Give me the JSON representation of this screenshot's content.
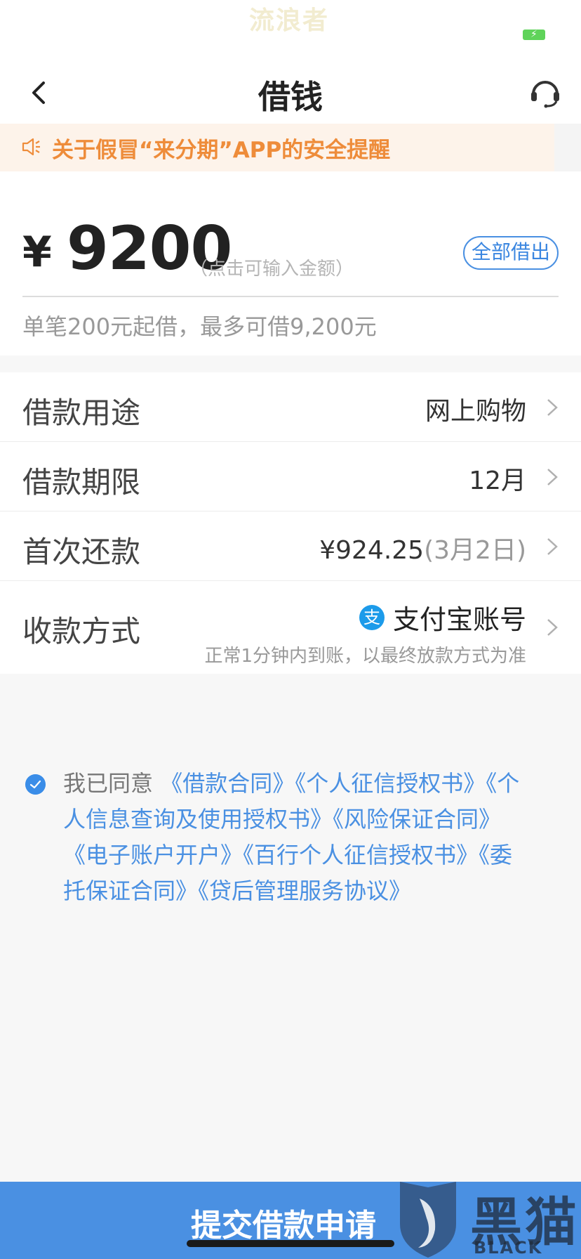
{
  "status_bar": {
    "watermark_text": "流浪者"
  },
  "nav": {
    "title": "借钱"
  },
  "notice": {
    "text": "关于假冒“来分期”APP的安全提醒"
  },
  "amount": {
    "currency": "¥",
    "value": "9200",
    "hint": "（点击可输入金额）",
    "borrow_all_label": "全部借出",
    "limit_note": "单笔200元起借，最多可借9,200元"
  },
  "options": [
    {
      "label": "借款用途",
      "value": "网上购物"
    },
    {
      "label": "借款期限",
      "value": "12月"
    },
    {
      "label": "首次还款",
      "value": "¥924.25",
      "value_sub": "(3月2日)"
    },
    {
      "label": "收款方式",
      "value": "支付宝账号",
      "note": "正常1分钟内到账，以最终放款方式为准",
      "icon_char": "支"
    }
  ],
  "agreement": {
    "prefix": "我已同意",
    "links": "《借款合同》《个人征信授权书》《个人信息查询及使用授权书》《风险保证合同》《电子账户开户》《百行个人征信授权书》《委托保证合同》《贷后管理服务协议》"
  },
  "submit": {
    "label": "提交借款申请"
  },
  "watermark": {
    "title": "黑猫",
    "subtitle": "BLACK CAT"
  },
  "colors": {
    "accent": "#4a90e2",
    "notice_text": "#ee8c3a",
    "notice_bg": "#fdf3ea"
  }
}
